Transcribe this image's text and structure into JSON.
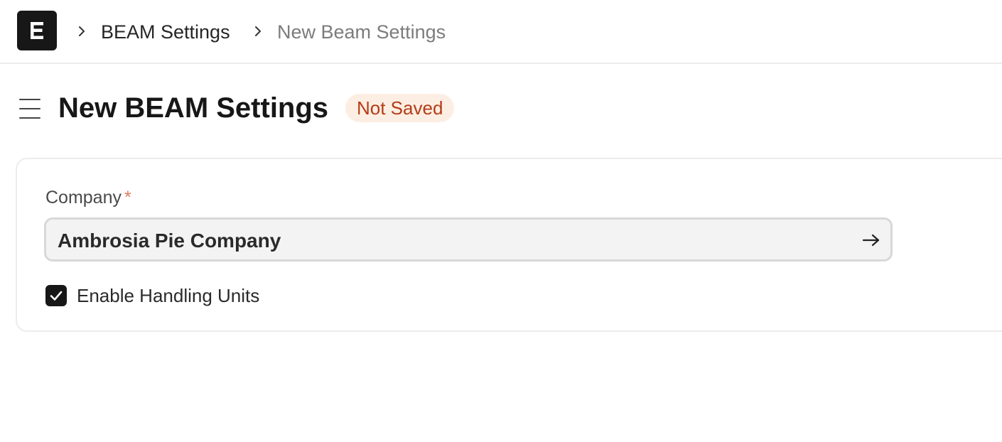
{
  "navbar": {
    "logo_icon": "app-logo-icon",
    "breadcrumbs": [
      {
        "label": "BEAM Settings"
      },
      {
        "label": "New Beam Settings"
      }
    ]
  },
  "page": {
    "title": "New BEAM Settings",
    "status": "Not Saved",
    "sidebar_toggle_icon": "hamburger-menu-icon"
  },
  "form": {
    "company": {
      "label": "Company",
      "required_mark": "*",
      "value": "Ambrosia Pie Company",
      "link_icon": "arrow-right-icon"
    },
    "enable_handling_units": {
      "label": "Enable Handling Units",
      "checked": true
    }
  },
  "colors": {
    "status_badge_bg": "#fdeee3",
    "status_badge_text": "#b33d17",
    "required_mark": "#e07a5f",
    "logo_bg": "#171717"
  }
}
